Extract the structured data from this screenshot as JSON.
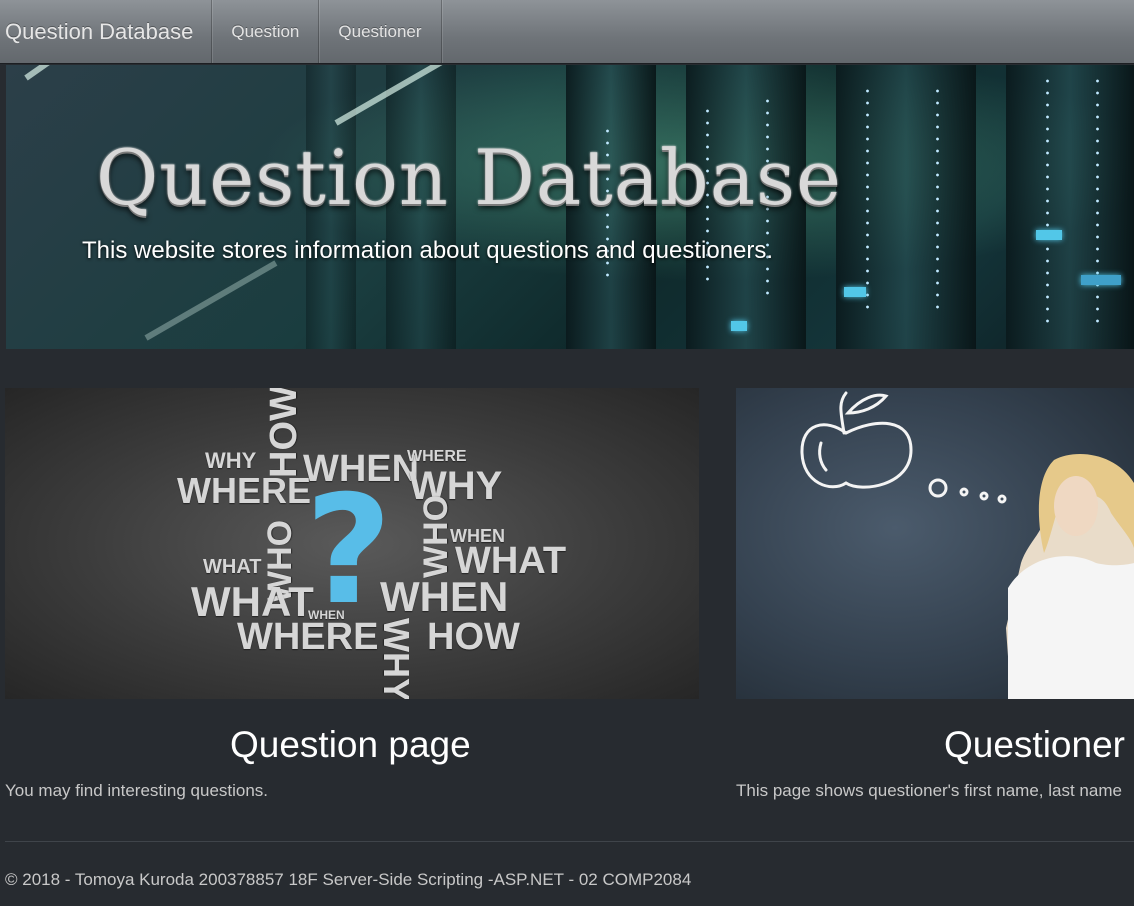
{
  "navbar": {
    "brand": "Question Database",
    "links": [
      "Question",
      "Questioner"
    ]
  },
  "hero": {
    "title": "Question Database",
    "subtitle": "This website stores information about questions and questioners."
  },
  "cards": [
    {
      "title": "Question page",
      "text": "You may find interesting questions."
    },
    {
      "title": "Questioner",
      "text": "This page shows questioner's first name, last name"
    }
  ],
  "question_image_words": {
    "why": "WHY",
    "where": "WHERE",
    "when": "WHEN",
    "what": "WHAT",
    "who": "WHO",
    "how": "HOW",
    "how_small": "HOW",
    "where_small": "WHERE",
    "what_small": "WHAT",
    "who_small": "WHO"
  },
  "footer": {
    "text": "© 2018 - Tomoya Kuroda 200378857 18F Server-Side Scripting -ASP.NET - 02 COMP2084"
  },
  "colors": {
    "background": "#272b30",
    "navbar": "#7a7f84",
    "question_mark": "#58bde8"
  }
}
